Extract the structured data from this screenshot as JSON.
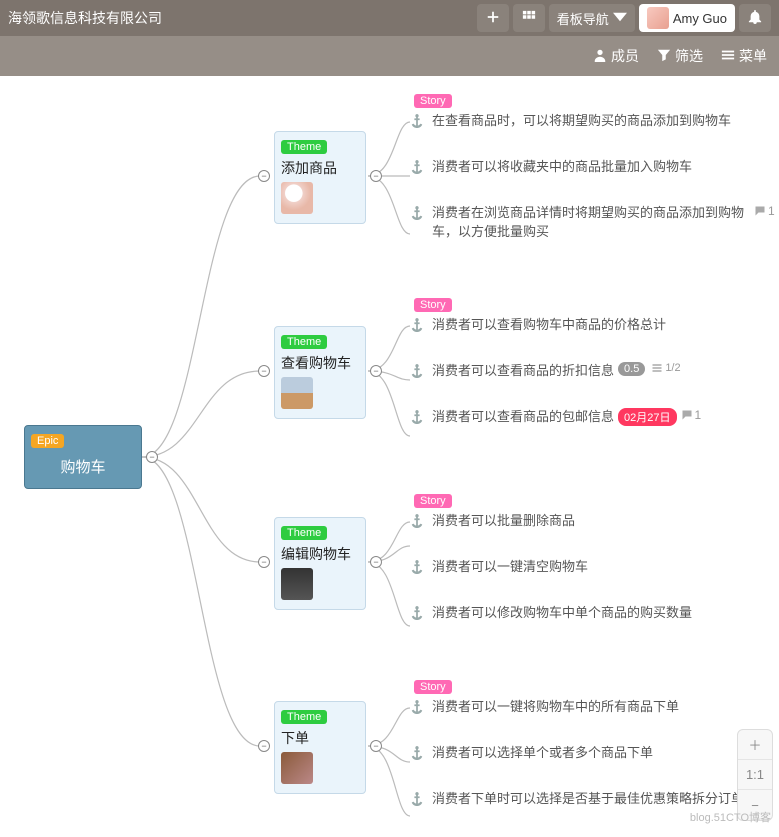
{
  "header": {
    "company": "海领歌信息科技有限公司",
    "nav_label": "看板导航",
    "user_name": "Amy Guo"
  },
  "secondbar": {
    "members": "成员",
    "filter": "筛选",
    "menu": "菜单"
  },
  "root": {
    "tag": "Epic",
    "title": "购物车"
  },
  "themes": [
    {
      "tag": "Theme",
      "title": "添加商品",
      "story_tag": "Story",
      "stories": [
        "在查看商品时，可以将期望购买的商品添加到购物车",
        "消费者可以将收藏夹中的商品批量加入购物车",
        "消费者在浏览商品详情时将期望购买的商品添加到购物车，以方便批量购买"
      ],
      "story_meta": [
        {},
        {},
        {
          "comments": "1"
        }
      ]
    },
    {
      "tag": "Theme",
      "title": "查看购物车",
      "story_tag": "Story",
      "stories": [
        "消费者可以查看购物车中商品的价格总计",
        "消费者可以查看商品的折扣信息",
        "消费者可以查看商品的包邮信息"
      ],
      "story_meta": [
        {},
        {
          "estimate": "0.5",
          "tasks": "1/2"
        },
        {
          "date": "02月27日",
          "comments": "1"
        }
      ]
    },
    {
      "tag": "Theme",
      "title": "编辑购物车",
      "story_tag": "Story",
      "stories": [
        "消费者可以批量删除商品",
        "消费者可以一键清空购物车",
        "消费者可以修改购物车中单个商品的购买数量"
      ],
      "story_meta": [
        {},
        {},
        {}
      ]
    },
    {
      "tag": "Theme",
      "title": "下单",
      "story_tag": "Story",
      "stories": [
        "消费者可以一键将购物车中的所有商品下单",
        "消费者可以选择单个或者多个商品下单",
        "消费者下单时可以选择是否基于最佳优惠策略拆分订单"
      ],
      "story_meta": [
        {},
        {},
        {}
      ]
    }
  ],
  "zoom": {
    "label_1_1": "1:1"
  },
  "watermark": "blog.51CTO博客"
}
